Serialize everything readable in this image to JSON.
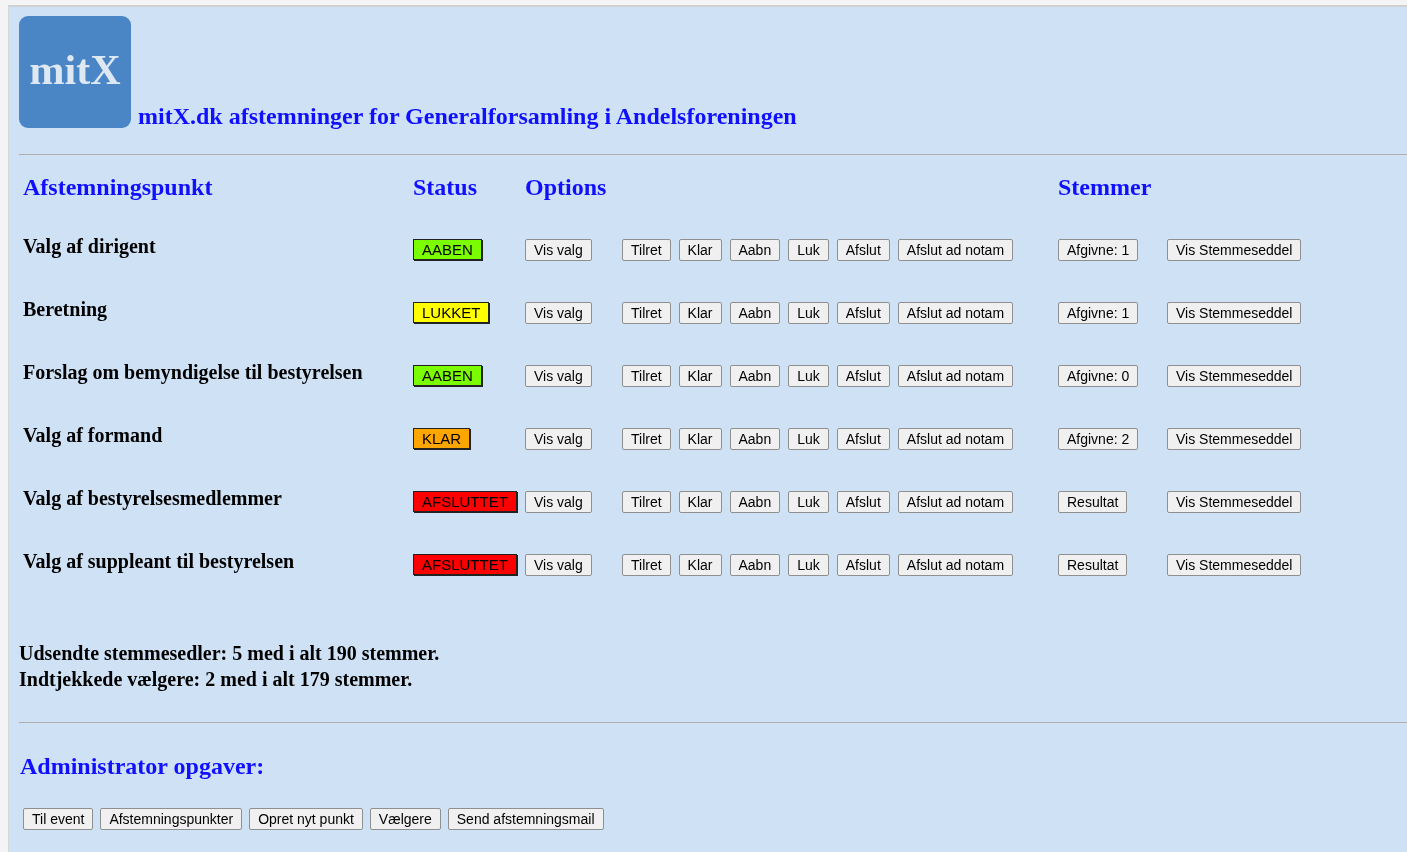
{
  "header": {
    "logo_text": "mitX",
    "title": "mitX.dk afstemninger for Generalforsamling i Andelsforeningen"
  },
  "table": {
    "columns": [
      "Afstemningspunkt",
      "Status",
      "Options",
      "Stemmer"
    ],
    "rows": [
      {
        "name": "Valg af dirigent",
        "status": {
          "label": "AABEN",
          "color": "#7cfc00"
        },
        "options": [
          "Vis valg"
        ],
        "actions": [
          "Tilret",
          "Klar",
          "Aabn",
          "Luk",
          "Afslut",
          "Afslut ad notam"
        ],
        "votes": "Afgivne: 1",
        "ballot": "Vis Stemmeseddel"
      },
      {
        "name": "Beretning",
        "status": {
          "label": "LUKKET",
          "color": "#ffff00"
        },
        "options": [
          "Vis valg"
        ],
        "actions": [
          "Tilret",
          "Klar",
          "Aabn",
          "Luk",
          "Afslut",
          "Afslut ad notam"
        ],
        "votes": "Afgivne: 1",
        "ballot": "Vis Stemmeseddel"
      },
      {
        "name": "Forslag om bemyndigelse til bestyrelsen",
        "status": {
          "label": "AABEN",
          "color": "#7cfc00"
        },
        "options": [
          "Vis valg"
        ],
        "actions": [
          "Tilret",
          "Klar",
          "Aabn",
          "Luk",
          "Afslut",
          "Afslut ad notam"
        ],
        "votes": "Afgivne: 0",
        "ballot": "Vis Stemmeseddel"
      },
      {
        "name": "Valg af formand",
        "status": {
          "label": "KLAR",
          "color": "#ffa500"
        },
        "options": [
          "Vis valg"
        ],
        "actions": [
          "Tilret",
          "Klar",
          "Aabn",
          "Luk",
          "Afslut",
          "Afslut ad notam"
        ],
        "votes": "Afgivne: 2",
        "ballot": "Vis Stemmeseddel"
      },
      {
        "name": "Valg af bestyrelsesmedlemmer",
        "status": {
          "label": "AFSLUTTET",
          "color": "#ff0000"
        },
        "options": [
          "Vis valg"
        ],
        "actions": [
          "Tilret",
          "Klar",
          "Aabn",
          "Luk",
          "Afslut",
          "Afslut ad notam"
        ],
        "votes": "Resultat",
        "ballot": "Vis Stemmeseddel"
      },
      {
        "name": "Valg af suppleant til bestyrelsen",
        "status": {
          "label": "AFSLUTTET",
          "color": "#ff0000"
        },
        "options": [
          "Vis valg"
        ],
        "actions": [
          "Tilret",
          "Klar",
          "Aabn",
          "Luk",
          "Afslut",
          "Afslut ad notam"
        ],
        "votes": "Resultat",
        "ballot": "Vis Stemmeseddel"
      }
    ]
  },
  "summary": [
    "Udsendte stemmesedler: 5 med i alt 190 stemmer.",
    "Indtjekkede vælgere: 2 med i alt 179 stemmer."
  ],
  "admin": {
    "title": "Administrator opgaver:",
    "buttons": [
      "Til event",
      "Afstemningspunkter",
      "Opret nyt punkt",
      "Vælgere",
      "Send afstemningsmail"
    ]
  }
}
